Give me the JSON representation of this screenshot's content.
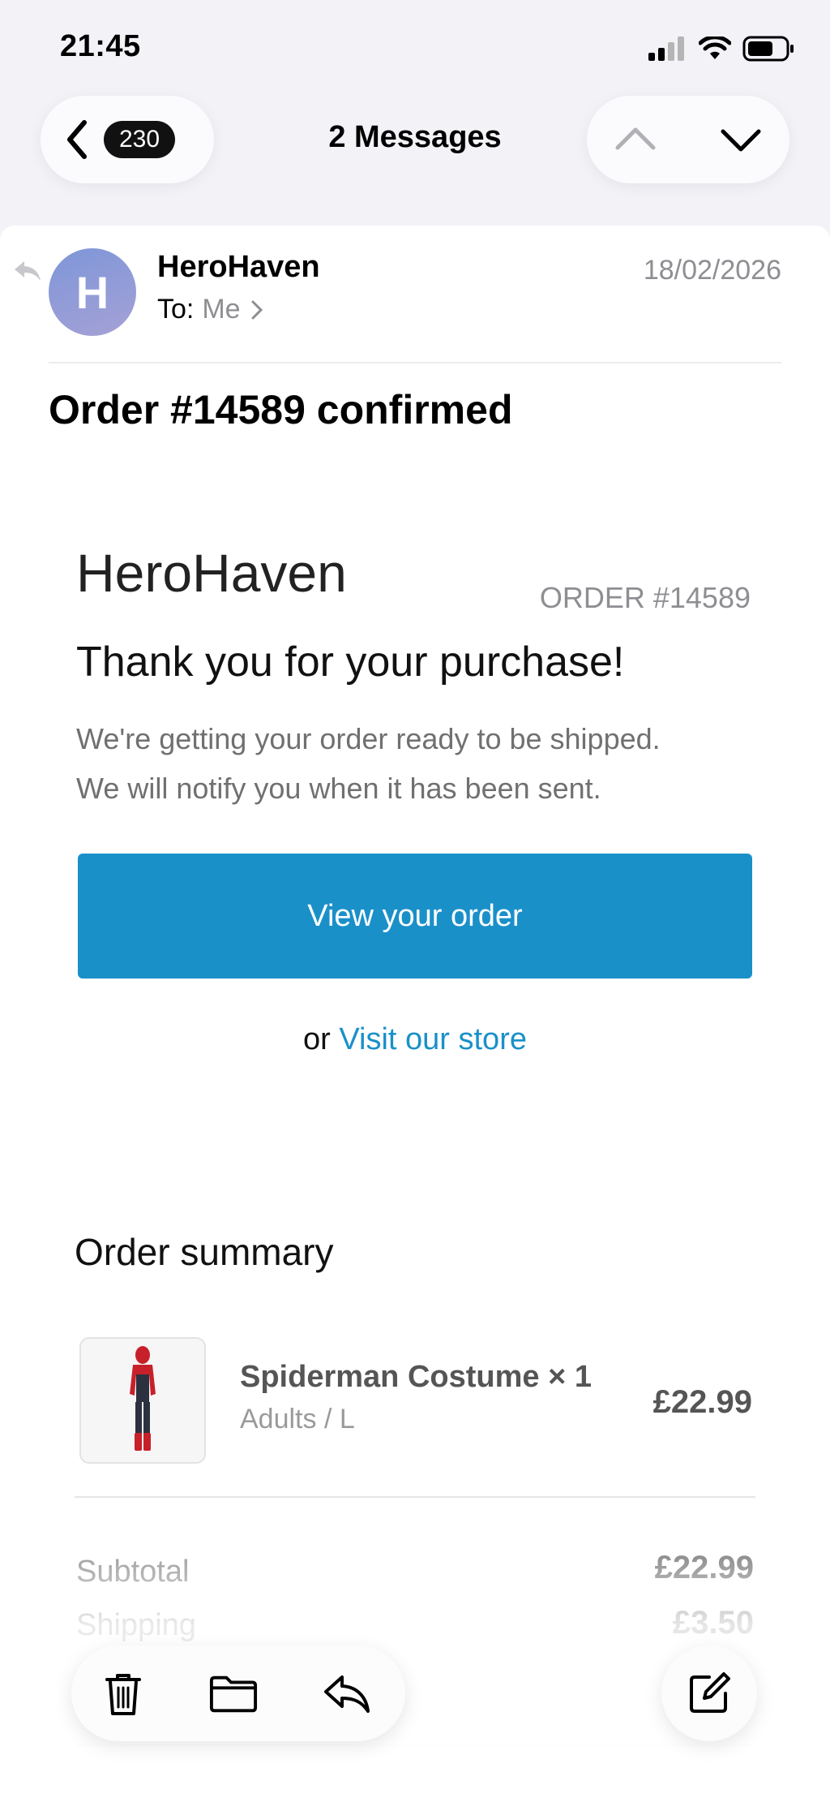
{
  "status_bar": {
    "time": "21:45"
  },
  "nav": {
    "badge_count": "230",
    "title": "2 Messages"
  },
  "email": {
    "avatar_initial": "H",
    "sender": "HeroHaven",
    "to_label": "To:",
    "to_value": "Me",
    "date": "18/02/2026",
    "subject": "Order #14589 confirmed"
  },
  "body": {
    "brand": "HeroHaven",
    "order_number": "ORDER #14589",
    "thank_you": "Thank you for your purchase!",
    "message_line1": "We're getting your order ready to be shipped.",
    "message_line2": "We will notify you when it has been sent.",
    "cta_label": "View your order",
    "or_text": "or",
    "store_link": "Visit our store",
    "accent_color": "#1a90c9"
  },
  "summary": {
    "title": "Order summary",
    "items": [
      {
        "name": "Spiderman Costume × 1",
        "variant": "Adults / L",
        "price": "£22.99"
      }
    ],
    "subtotal_label": "Subtotal",
    "subtotal_value": "£22.99",
    "shipping_label": "Shipping",
    "shipping_value": "£3.50"
  },
  "toolbar": {
    "icons": [
      "trash-icon",
      "folder-icon",
      "reply-icon",
      "compose-icon"
    ]
  }
}
